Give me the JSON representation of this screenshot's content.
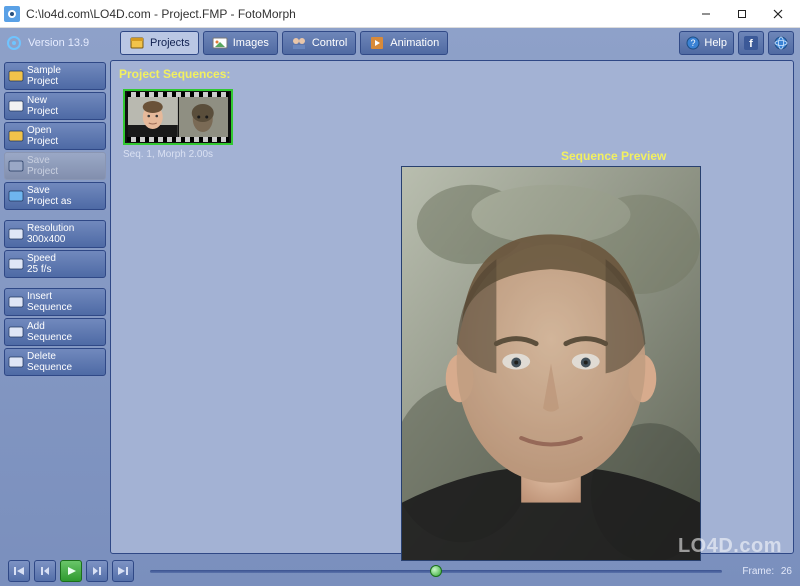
{
  "window": {
    "title": "C:\\lo4d.com\\LO4D.com - Project.FMP - FotoMorph"
  },
  "topbar": {
    "version_label": "Version 13.9",
    "tabs": [
      {
        "label": "Projects",
        "icon": "projects-icon",
        "active": true
      },
      {
        "label": "Images",
        "icon": "images-icon",
        "active": false
      },
      {
        "label": "Control",
        "icon": "control-icon",
        "active": false
      },
      {
        "label": "Animation",
        "icon": "animation-icon",
        "active": false
      }
    ],
    "help_label": "Help"
  },
  "sidebar": {
    "groups": [
      [
        {
          "label": "Sample\nProject",
          "icon_color": "#f2c34a",
          "disabled": false
        },
        {
          "label": "New\nProject",
          "icon_color": "#f2f2f2",
          "disabled": false
        },
        {
          "label": "Open\nProject",
          "icon_color": "#f2c34a",
          "disabled": false
        },
        {
          "label": "Save\nProject",
          "icon_color": "#9aa8c6",
          "disabled": true
        },
        {
          "label": "Save\nProject as",
          "icon_color": "#6fb5ef",
          "disabled": false
        }
      ],
      [
        {
          "label": "Resolution\n300x400",
          "icon_color": "#dfe6f6",
          "disabled": false
        },
        {
          "label": "Speed\n25 f/s",
          "icon_color": "#dfe6f6",
          "disabled": false
        }
      ],
      [
        {
          "label": "Insert\nSequence",
          "icon_color": "#dfe6f6",
          "disabled": false
        },
        {
          "label": "Add\nSequence",
          "icon_color": "#dfe6f6",
          "disabled": false
        },
        {
          "label": "Delete\nSequence",
          "icon_color": "#dfe6f6",
          "disabled": false
        }
      ]
    ]
  },
  "content": {
    "panel_title": "Project Sequences:",
    "sequence_caption": "Seq. 1,  Morph 2.00s",
    "preview_title": "Sequence Preview"
  },
  "playback": {
    "frame_label": "Frame:",
    "frame_value": "26",
    "slider_percent": 50
  },
  "watermark": "LO4D.com",
  "colors": {
    "accent_yellow": "#f2f060",
    "panel_bg": "#a3b2d4",
    "app_bg_top": "#8ea1c9"
  }
}
